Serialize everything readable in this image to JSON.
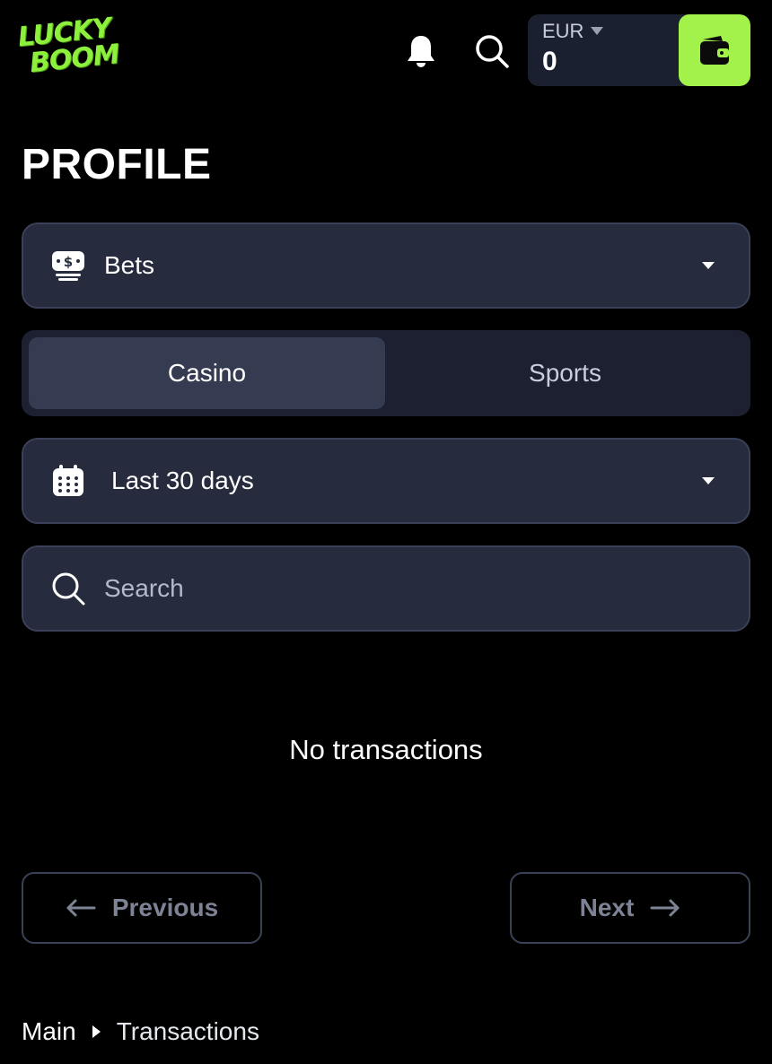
{
  "brand": {
    "logo_line1": "LUCKY",
    "logo_line2": "BOOM",
    "accent_color": "#a3f24c"
  },
  "header": {
    "icons": [
      "bell-icon",
      "search-icon",
      "wallet-icon",
      "chevron-down-icon"
    ],
    "balance": {
      "currency": "EUR",
      "amount": "0"
    }
  },
  "page": {
    "title": "PROFILE"
  },
  "filters": {
    "section_select": {
      "icon": "cash-stack-icon",
      "value": "Bets"
    },
    "tabs": [
      {
        "label": "Casino",
        "active": true
      },
      {
        "label": "Sports",
        "active": false
      }
    ],
    "period_select": {
      "icon": "calendar-icon",
      "value": "Last 30 days"
    },
    "search": {
      "placeholder": "Search",
      "value": ""
    }
  },
  "results": {
    "empty_message": "No transactions"
  },
  "pagination": {
    "previous_label": "Previous",
    "next_label": "Next"
  },
  "breadcrumb": {
    "items": [
      "Main",
      "Transactions"
    ]
  }
}
